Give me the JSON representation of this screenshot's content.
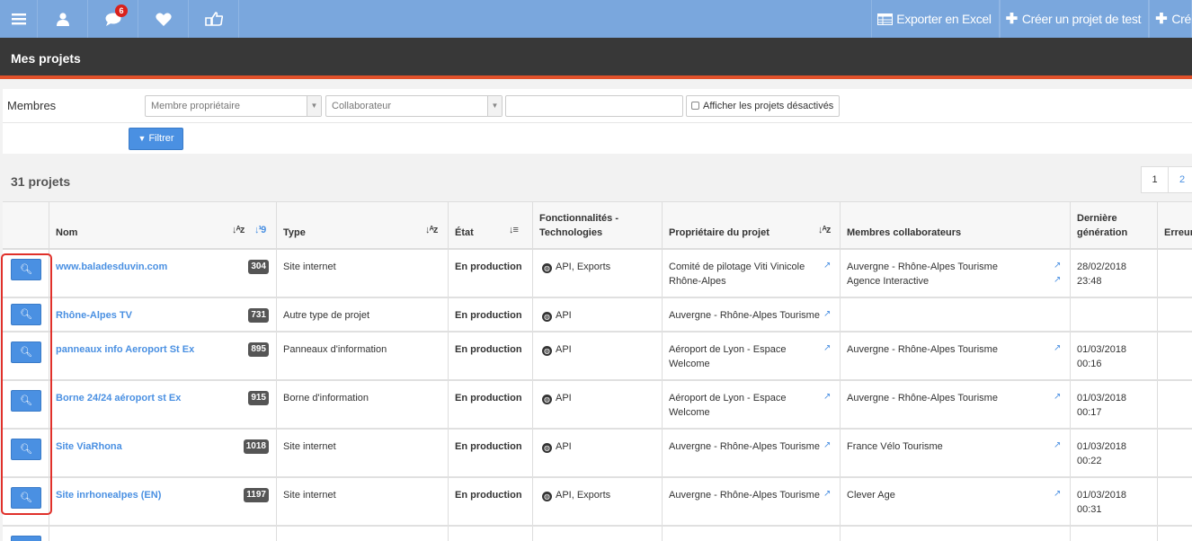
{
  "nav": {
    "badge_count": "6",
    "export_label": "Exporter en Excel",
    "create_test_label": "Créer un projet de test",
    "create_label": "Cré"
  },
  "page_title": "Mes projets",
  "filters": {
    "label": "Membres",
    "owner_placeholder": "Membre propriétaire",
    "collab_placeholder": "Collaborateur",
    "show_disabled_label": "Afficher les projets désactivés",
    "filter_button": "Filtrer"
  },
  "count_label": "31 projets",
  "pagination": [
    "1",
    "2"
  ],
  "columns": {
    "name": "Nom",
    "type": "Type",
    "state": "État",
    "features": "Fonctionnalités - Technologies",
    "owner": "Propriétaire du projet",
    "members": "Membres collaborateurs",
    "last_gen": "Dernière génération",
    "errors": "Erreur"
  },
  "rows": [
    {
      "name": "www.baladesduvin.com",
      "id": "304",
      "type": "Site internet",
      "state": "En production",
      "features": "API, Exports",
      "owner": "Comité de pilotage Viti Vinicole Rhône-Alpes",
      "members": [
        "Auvergne - Rhône-Alpes Tourisme",
        "Agence Interactive"
      ],
      "date": "28/02/2018",
      "time": "23:48"
    },
    {
      "name": "Rhône-Alpes TV",
      "id": "731",
      "type": "Autre type de projet",
      "state": "En production",
      "features": "API",
      "owner": "Auvergne - Rhône-Alpes Tourisme",
      "members": [],
      "date": "",
      "time": ""
    },
    {
      "name": "panneaux info Aeroport St Ex",
      "id": "895",
      "type": "Panneaux d'information",
      "state": "En production",
      "features": "API",
      "owner": "Aéroport de Lyon - Espace Welcome",
      "members": [
        "Auvergne - Rhône-Alpes Tourisme"
      ],
      "date": "01/03/2018",
      "time": "00:16"
    },
    {
      "name": "Borne 24/24 aéroport st Ex",
      "id": "915",
      "type": "Borne d'information",
      "state": "En production",
      "features": "API",
      "owner": "Aéroport de Lyon - Espace Welcome",
      "members": [
        "Auvergne - Rhône-Alpes Tourisme"
      ],
      "date": "01/03/2018",
      "time": "00:17"
    },
    {
      "name": "Site ViaRhona",
      "id": "1018",
      "type": "Site internet",
      "state": "En production",
      "features": "API",
      "owner": "Auvergne - Rhône-Alpes Tourisme",
      "members": [
        "France Vélo Tourisme"
      ],
      "date": "01/03/2018",
      "time": "00:22"
    },
    {
      "name": "Site inrhonealpes (EN)",
      "id": "1197",
      "type": "Site internet",
      "state": "En production",
      "features": "API, Exports",
      "owner": "Auvergne - Rhône-Alpes Tourisme",
      "members": [
        "Clever Age"
      ],
      "date": "01/03/2018",
      "time": "00:31"
    }
  ]
}
